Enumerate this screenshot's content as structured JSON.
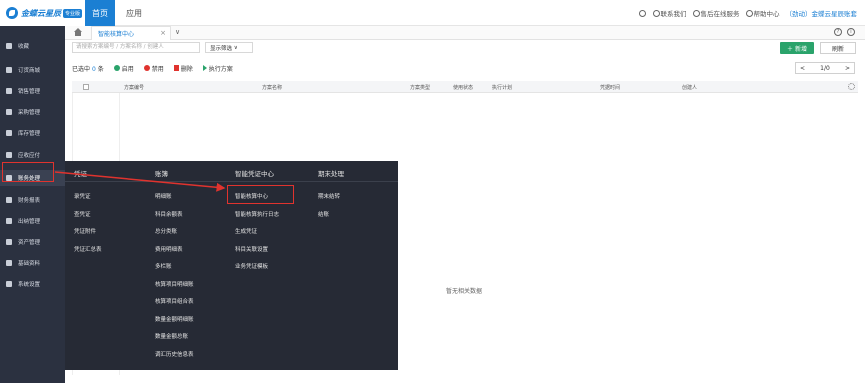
{
  "brand": {
    "name": "金蝶云星辰",
    "badge": "专业版"
  },
  "topnav": {
    "home": "首页",
    "app": "应用"
  },
  "topright": {
    "contact": "联系我们",
    "service": "售后在线服务",
    "help": "帮助中心",
    "account": "（劲动）金蝶云星辰账套"
  },
  "sidebar": {
    "items": [
      {
        "label": "收藏"
      },
      {
        "label": "订货商城"
      },
      {
        "label": "销售管理"
      },
      {
        "label": "采购管理"
      },
      {
        "label": "库存管理"
      },
      {
        "label": "应收应付"
      },
      {
        "label": "账务处理"
      },
      {
        "label": "财务报表"
      },
      {
        "label": "出纳管理"
      },
      {
        "label": "资产管理"
      },
      {
        "label": "基础资料"
      },
      {
        "label": "系统设置"
      }
    ]
  },
  "tabs": {
    "active": "智能核算中心"
  },
  "filter": {
    "search_placeholder": "请搜索方案编号 / 方案名称 / 创建人",
    "filter_button": "显示筛选",
    "new_button": "新增",
    "refresh_button": "刷新"
  },
  "actions": {
    "selected_prefix": "已选中",
    "selected_count": "0",
    "selected_suffix": "条",
    "apply": "启用",
    "disable": "禁用",
    "delete": "删除",
    "execute": "执行方案"
  },
  "pager": {
    "prev": "<",
    "page": "1/0",
    "next": ">"
  },
  "table": {
    "columns": [
      "方案编号",
      "方案名称",
      "方案类型",
      "使用状态",
      "执行计划",
      "凭据时间",
      "创建人"
    ],
    "empty_text": "暂无相关数据"
  },
  "menu": {
    "groups": [
      {
        "title": "凭证",
        "items": [
          "录凭证",
          "查凭证",
          "凭证附件",
          "凭证汇总表"
        ]
      },
      {
        "title": "账簿",
        "items": [
          "明细账",
          "科目余额表",
          "总分类账",
          "费用明细表",
          "多栏账",
          "核算项目明细账",
          "核算项目组合表",
          "数量金额明细账",
          "数量金额总账",
          "调汇历史信息表"
        ]
      },
      {
        "title": "智能凭证中心",
        "items": [
          "智能核算中心",
          "智能核算执行日志",
          "生成凭证",
          "科目关联设置",
          "业务凭证模板"
        ]
      },
      {
        "title": "期末处理",
        "items": [
          "期末结转",
          "结账"
        ]
      }
    ]
  },
  "colors": {
    "accent": "#1b7fd3",
    "sidebar": "#2b3140",
    "menu": "#262a35",
    "highlight": "#e0332e",
    "success": "#2aa36b"
  }
}
